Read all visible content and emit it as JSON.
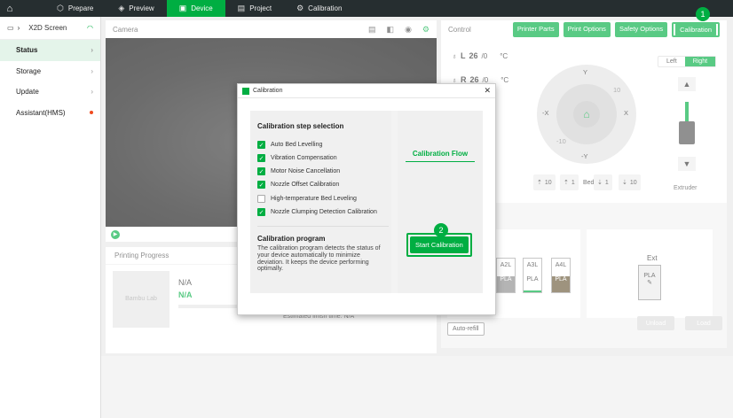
{
  "topbar": {
    "tabs": [
      {
        "label": "Prepare",
        "icon": "cube-icon"
      },
      {
        "label": "Preview",
        "icon": "layers-icon"
      },
      {
        "label": "Device",
        "icon": "device-icon"
      },
      {
        "label": "Project",
        "icon": "project-icon"
      },
      {
        "label": "Calibration",
        "icon": "gear-icon"
      }
    ],
    "active_tab": "Device"
  },
  "sidebar": {
    "printer_name": "X2D Screen",
    "items": [
      {
        "label": "Status"
      },
      {
        "label": "Storage"
      },
      {
        "label": "Update"
      },
      {
        "label": "Assistant(HMS)"
      }
    ]
  },
  "camera": {
    "title": "Camera"
  },
  "progress": {
    "title": "Printing Progress",
    "thumb_text": "Bambu Lab",
    "name": "N/A",
    "status": "N/A",
    "estimated": "Estimated finish time: N/A"
  },
  "control": {
    "title": "Control",
    "buttons": [
      "Printer Parts",
      "Print Options",
      "Safety Options",
      "Calibration"
    ],
    "temps": [
      {
        "nozzle": "L",
        "current": "26",
        "target": "/0",
        "unit": "°C"
      },
      {
        "nozzle": "R",
        "current": "26",
        "target": "/0",
        "unit": "°C"
      }
    ],
    "jog": {
      "y_up": "Y",
      "y_down": "-Y",
      "x_left": "-X",
      "x_right": "X",
      "d10": "10",
      "dm10": "-10"
    },
    "z": [
      {
        "label": "10"
      },
      {
        "label": "1"
      },
      {
        "label": "Bed"
      },
      {
        "label": "1"
      },
      {
        "label": "10"
      }
    ],
    "side_toggle": {
      "left": "Left",
      "right": "Right"
    },
    "extruder_label": "Extruder",
    "ams": {
      "slots": [
        {
          "tag": "A2L",
          "label": "PLA",
          "color": "#8c8c8c"
        },
        {
          "tag": "A3L",
          "label": "PLA",
          "color": "#ffffff"
        },
        {
          "tag": "A4L",
          "label": "PLA",
          "color": "#6b5a3a"
        }
      ],
      "ext_label": "Ext",
      "ext_slot_label": "PLA",
      "auto_refill": "Auto-refill",
      "unload": "Unload",
      "load": "Load"
    }
  },
  "dialog": {
    "title": "Calibration",
    "step_title": "Calibration step selection",
    "steps": [
      {
        "label": "Auto Bed Levelling",
        "checked": true
      },
      {
        "label": "Vibration Compensation",
        "checked": true
      },
      {
        "label": "Motor Noise Cancellation",
        "checked": true
      },
      {
        "label": "Nozzle Offset Calibration",
        "checked": true
      },
      {
        "label": "High-temperature Bed Leveling",
        "checked": false
      },
      {
        "label": "Nozzle Clumping Detection Calibration",
        "checked": true
      }
    ],
    "program_title": "Calibration program",
    "program_desc": "The calibration program detects the status of your device automatically to minimize deviation. It keeps the device performing optimally.",
    "flow_title": "Calibration Flow",
    "start_button": "Start Calibration"
  },
  "annotations": {
    "badge1": "1",
    "badge2": "2"
  },
  "colors": {
    "accent": "#00ae42",
    "topbar": "#262e30"
  }
}
